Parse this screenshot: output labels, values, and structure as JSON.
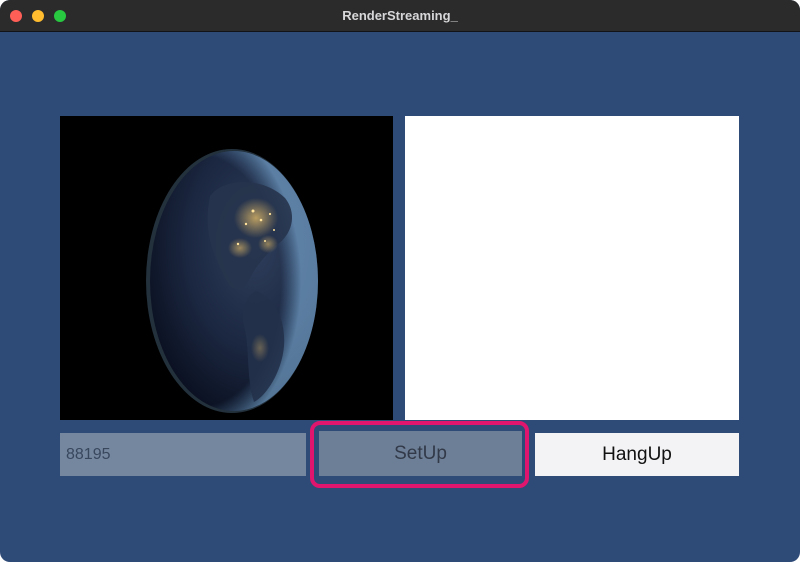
{
  "window": {
    "title": "RenderStreaming_"
  },
  "input": {
    "value": "88195"
  },
  "buttons": {
    "setup_label": "SetUp",
    "hangup_label": "HangUp"
  },
  "colors": {
    "background": "#2e4a77",
    "titlebar": "#2b2b2c",
    "highlight": "#e0166e",
    "input": "#74879f",
    "setup": "#6d7f96",
    "hangup": "#f3f3f5"
  },
  "icons": {
    "close": "close-icon",
    "minimize": "minimize-icon",
    "zoom": "zoom-icon"
  }
}
